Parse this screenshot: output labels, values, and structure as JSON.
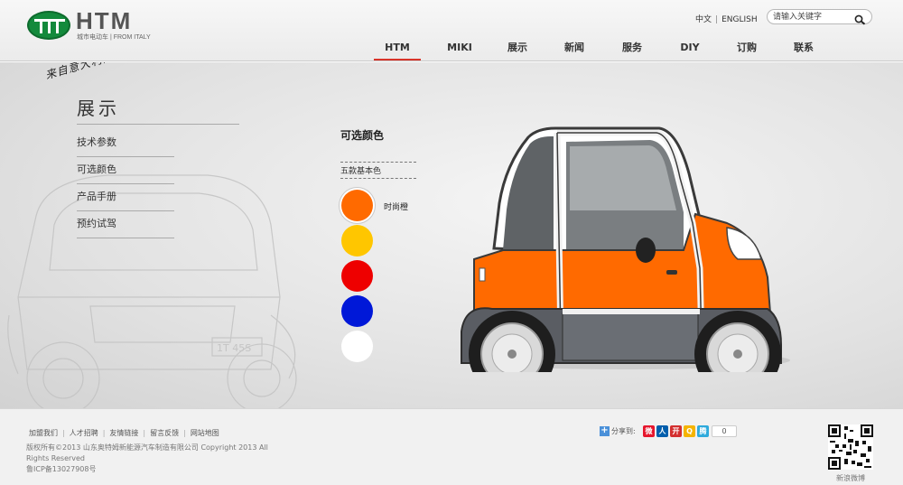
{
  "brand": {
    "name": "HTM",
    "tagline": "城市电动车 | FROM ITALY"
  },
  "header": {
    "lang": {
      "zh": "中文",
      "separator": "|",
      "en": "ENGLISH"
    },
    "search": {
      "placeholder": "请输入关键字"
    },
    "nav": [
      {
        "label": "HTM",
        "active": true
      },
      {
        "label": "MIKI",
        "active": false
      },
      {
        "label": "展示",
        "active": false
      },
      {
        "label": "新闻",
        "active": false
      },
      {
        "label": "服务",
        "active": false
      },
      {
        "label": "DIY",
        "active": false
      },
      {
        "label": "订购",
        "active": false
      },
      {
        "label": "联系",
        "active": false
      }
    ]
  },
  "main": {
    "handwriting": "来自意大利的城市小精灵",
    "section_title": "展示",
    "side_menu": [
      "技术参数",
      "可选颜色",
      "产品手册",
      "预约试驾"
    ],
    "colors": {
      "title": "可选颜色",
      "subtitle": "五款基本色",
      "swatches": [
        {
          "color": "#ff6a00",
          "label": "时尚橙",
          "selected": true
        },
        {
          "color": "#ffc600",
          "label": "",
          "selected": false
        },
        {
          "color": "#ee0000",
          "label": "",
          "selected": false
        },
        {
          "color": "#0018d8",
          "label": "",
          "selected": false
        },
        {
          "color": "#ffffff",
          "label": "",
          "selected": false
        }
      ]
    },
    "car": {
      "body_color": "#ff6a00",
      "plate_sketch": "1T 45S"
    }
  },
  "footer": {
    "links": [
      "加盟我们",
      "人才招聘",
      "友情链接",
      "留言反馈",
      "网站地图"
    ],
    "copyright": "版权所有©2013 山东奥特姆新能源汽车制造有限公司 Copyright 2013 All Rights Reserved",
    "icp": "鲁ICP备13027908号",
    "share": {
      "label": "分享到:",
      "icons": [
        {
          "name": "weibo-icon",
          "glyph": "微",
          "color": "#e6162d"
        },
        {
          "name": "renren-icon",
          "glyph": "人",
          "color": "#005eac"
        },
        {
          "name": "kaixin-icon",
          "glyph": "开",
          "color": "#d32f2f"
        },
        {
          "name": "qzone-icon",
          "glyph": "Q",
          "color": "#f5b400"
        },
        {
          "name": "qq-weibo-icon",
          "glyph": "腾",
          "color": "#2eaadc"
        }
      ],
      "count": "0"
    },
    "qr_label": "新浪微博"
  }
}
